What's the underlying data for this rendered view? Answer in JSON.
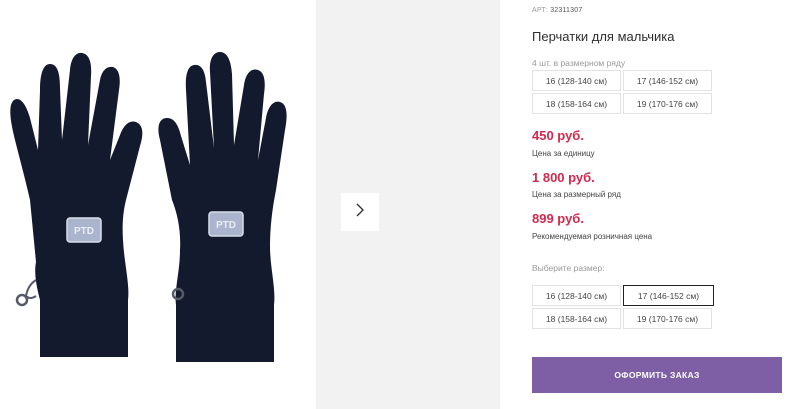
{
  "product": {
    "art_label": "АРТ:",
    "art_value": "32311307",
    "title": "Перчатки для мальчика",
    "pack_note": "4 шт. в размерном ряду",
    "pack_sizes": [
      "16 (128-140 см)",
      "17 (146-152 см)",
      "18 (158-164 см)",
      "19 (170-176 см)"
    ],
    "patch_text": "PTD"
  },
  "prices": {
    "unit_price": "450 руб.",
    "unit_caption": "Цена за единицу",
    "row_price": "1 800 руб.",
    "row_caption": "Цена за размерный ряд",
    "retail_price": "899 руб.",
    "retail_caption": "Рекомендуемая розничная цена"
  },
  "size_select": {
    "label": "Выберите размер:",
    "options": [
      "16 (128-140 см)",
      "17 (146-152 см)",
      "18 (158-164 см)",
      "19 (170-176 см)"
    ],
    "selected": "17 (146-152 см)"
  },
  "order_button_label": "ОФОРМИТЬ ЗАКАЗ",
  "colors": {
    "accent_button": "#7e5fa6",
    "price_red": "#d3284c",
    "glove_navy": "#141a2e"
  },
  "icons": {
    "gallery_next": "chevron-right-icon"
  }
}
